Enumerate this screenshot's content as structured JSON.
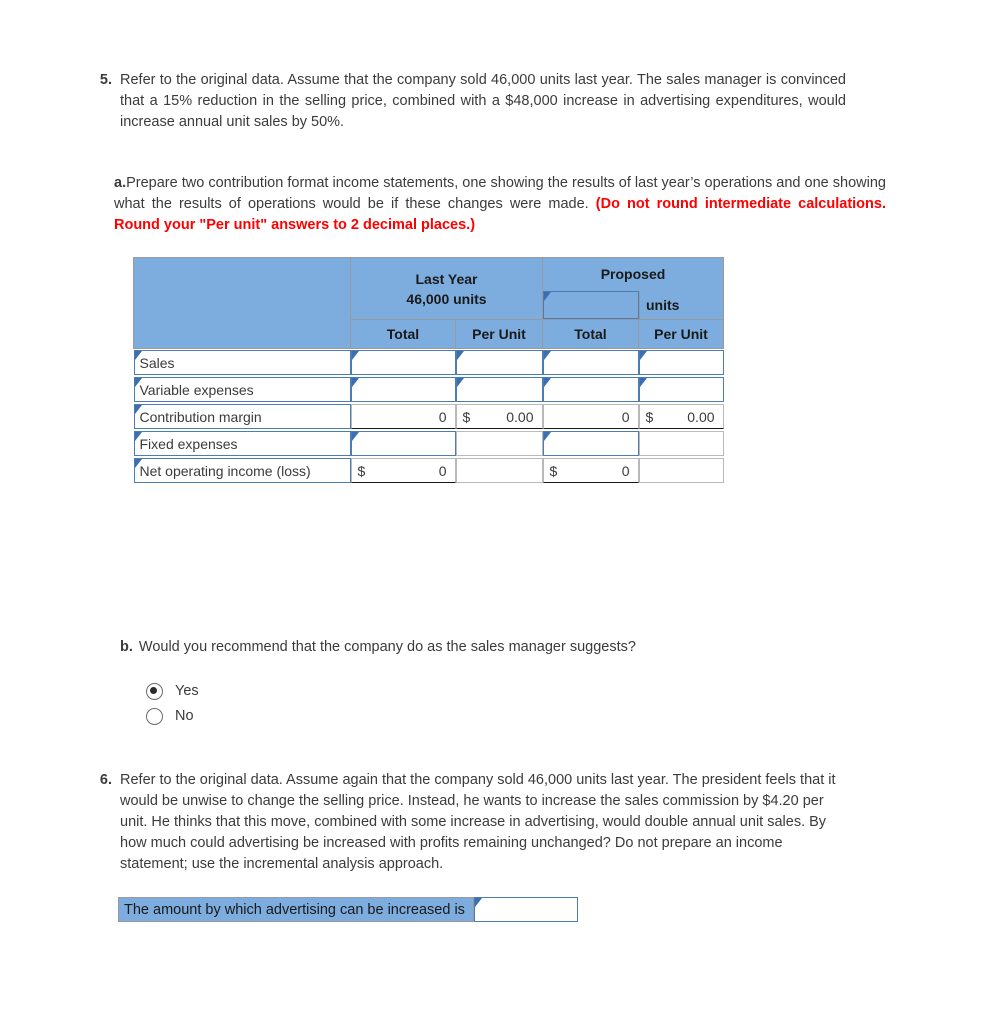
{
  "questions": {
    "q5": {
      "number": "5.",
      "text": "Refer to the original data. Assume that the company sold 46,000 units last year. The sales manager is convinced that a 15% reduction in the selling price, combined with a $48,000 increase in advertising expenditures, would increase annual unit sales by 50%."
    },
    "q6": {
      "number": "6.",
      "text": "Refer to the original data. Assume again that the company sold 46,000 units last year. The president feels that it would be unwise to change the selling price. Instead, he wants to increase the sales commission by $4.20 per unit. He thinks that this move, combined with some increase in advertising, would double annual unit sales. By how much could advertising be increased with profits remaining unchanged? Do not prepare an income statement; use the incremental analysis approach."
    }
  },
  "part_a": {
    "label": "a.",
    "text_normal": "Prepare two contribution format income statements, one showing the results of last year’s operations and one showing what the results of operations would be if these changes were made. ",
    "text_red": "(Do not round intermediate calculations. Round your \"Per unit\" answers to 2 decimal places.)"
  },
  "part_b": {
    "label": "b.",
    "text": "Would you recommend that the company do as the sales manager suggests?",
    "options": [
      {
        "label": "Yes",
        "selected": true
      },
      {
        "label": "No",
        "selected": false
      }
    ]
  },
  "table": {
    "corner_blank": "",
    "groups": [
      {
        "title_line1": "Last Year",
        "title_line2": "46,000 units"
      },
      {
        "title_line1": "Proposed",
        "units_value": "",
        "units_label": "units"
      }
    ],
    "subheaders": [
      "Total",
      "Per Unit",
      "Total",
      "Per Unit"
    ],
    "rows": [
      {
        "label": "Sales",
        "cells": [
          {
            "kind": "input",
            "value": ""
          },
          {
            "kind": "input",
            "value": ""
          },
          {
            "kind": "input",
            "value": ""
          },
          {
            "kind": "input",
            "value": ""
          }
        ]
      },
      {
        "label": "Variable expenses",
        "cells": [
          {
            "kind": "input",
            "value": ""
          },
          {
            "kind": "input",
            "value": ""
          },
          {
            "kind": "input",
            "value": ""
          },
          {
            "kind": "input",
            "value": ""
          }
        ]
      },
      {
        "label": "Contribution margin",
        "cells": [
          {
            "kind": "computed",
            "symbol": "",
            "value": "0"
          },
          {
            "kind": "computed",
            "symbol": "$",
            "value": "0.00"
          },
          {
            "kind": "computed",
            "symbol": "",
            "value": "0"
          },
          {
            "kind": "computed",
            "symbol": "$",
            "value": "0.00"
          }
        ]
      },
      {
        "label": "Fixed expenses",
        "cells": [
          {
            "kind": "input",
            "value": ""
          },
          {
            "kind": "empty",
            "value": ""
          },
          {
            "kind": "input",
            "value": ""
          },
          {
            "kind": "empty",
            "value": ""
          }
        ]
      },
      {
        "label": "Net operating income (loss)",
        "cells": [
          {
            "kind": "computed",
            "symbol": "$",
            "value": "0"
          },
          {
            "kind": "empty",
            "value": ""
          },
          {
            "kind": "computed",
            "symbol": "$",
            "value": "0"
          },
          {
            "kind": "empty",
            "value": ""
          }
        ]
      }
    ]
  },
  "answer_bar": {
    "label": "The amount by which advertising can be increased is",
    "value": ""
  },
  "colors": {
    "header_blue": "#7daddf",
    "input_border_blue": "#4a7cb5",
    "flag_blue": "#3c6fae",
    "instruction_red": "#ff0000",
    "text": "#3b3b3b"
  }
}
